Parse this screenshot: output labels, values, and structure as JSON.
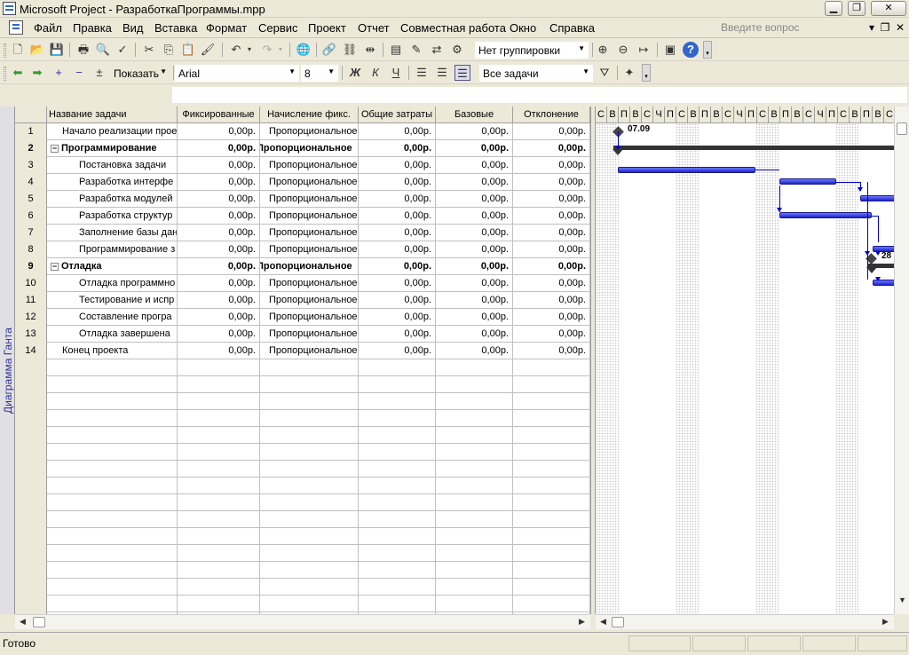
{
  "window": {
    "title": "Microsoft Project - РазработкаПрограммы.mpp"
  },
  "menu": {
    "items": [
      "Файл",
      "Правка",
      "Вид",
      "Вставка",
      "Формат",
      "Сервис",
      "Проект",
      "Отчет",
      "Совместная работа",
      "Окно",
      "Справка"
    ],
    "help_placeholder": "Введите вопрос"
  },
  "toolbar": {
    "grouping": "Нет группировки",
    "show_label": "Показать",
    "font": "Arial",
    "font_size": "8",
    "bold": "Ж",
    "italic": "К",
    "underline": "Ч",
    "filter": "Все задачи"
  },
  "view": {
    "label": "Диаграмма Ганта"
  },
  "table": {
    "columns": [
      "Название задачи",
      "Фиксированные",
      "Начисление фикс.",
      "Общие затраты",
      "Базовые",
      "Отклонение"
    ],
    "rows": [
      {
        "n": "1",
        "name": "Начало реализации прое",
        "fixed": "0,00р.",
        "accrual": "Пропорциональное",
        "total": "0,00р.",
        "baseline": "0,00р.",
        "variance": "0,00р."
      },
      {
        "n": "2",
        "name": "Программирование",
        "fixed": "0,00р.",
        "accrual": "Пропорциональное",
        "total": "0,00р.",
        "baseline": "0,00р.",
        "variance": "0,00р."
      },
      {
        "n": "3",
        "name": "Постановка задачи",
        "fixed": "0,00р.",
        "accrual": "Пропорциональное",
        "total": "0,00р.",
        "baseline": "0,00р.",
        "variance": "0,00р."
      },
      {
        "n": "4",
        "name": "Разработка интерфе",
        "fixed": "0,00р.",
        "accrual": "Пропорциональное",
        "total": "0,00р.",
        "baseline": "0,00р.",
        "variance": "0,00р."
      },
      {
        "n": "5",
        "name": "Разработка модулей",
        "fixed": "0,00р.",
        "accrual": "Пропорциональное",
        "total": "0,00р.",
        "baseline": "0,00р.",
        "variance": "0,00р."
      },
      {
        "n": "6",
        "name": "Разработка структур",
        "fixed": "0,00р.",
        "accrual": "Пропорциональное",
        "total": "0,00р.",
        "baseline": "0,00р.",
        "variance": "0,00р."
      },
      {
        "n": "7",
        "name": "Заполнение базы дан",
        "fixed": "0,00р.",
        "accrual": "Пропорциональное",
        "total": "0,00р.",
        "baseline": "0,00р.",
        "variance": "0,00р."
      },
      {
        "n": "8",
        "name": "Программирование з",
        "fixed": "0,00р.",
        "accrual": "Пропорциональное",
        "total": "0,00р.",
        "baseline": "0,00р.",
        "variance": "0,00р."
      },
      {
        "n": "9",
        "name": "Отладка",
        "fixed": "0,00р.",
        "accrual": "Пропорциональное",
        "total": "0,00р.",
        "baseline": "0,00р.",
        "variance": "0,00р."
      },
      {
        "n": "10",
        "name": "Отладка программно",
        "fixed": "0,00р.",
        "accrual": "Пропорциональное",
        "total": "0,00р.",
        "baseline": "0,00р.",
        "variance": "0,00р."
      },
      {
        "n": "11",
        "name": "Тестирование и испр",
        "fixed": "0,00р.",
        "accrual": "Пропорциональное",
        "total": "0,00р.",
        "baseline": "0,00р.",
        "variance": "0,00р."
      },
      {
        "n": "12",
        "name": "Составление програ",
        "fixed": "0,00р.",
        "accrual": "Пропорциональное",
        "total": "0,00р.",
        "baseline": "0,00р.",
        "variance": "0,00р."
      },
      {
        "n": "13",
        "name": "Отладка завершена",
        "fixed": "0,00р.",
        "accrual": "Пропорциональное",
        "total": "0,00р.",
        "baseline": "0,00р.",
        "variance": "0,00р."
      },
      {
        "n": "14",
        "name": "Конец проекта",
        "fixed": "0,00р.",
        "accrual": "Пропорциональное",
        "total": "0,00р.",
        "baseline": "0,00р.",
        "variance": "0,00р."
      }
    ]
  },
  "gantt": {
    "days": [
      "С",
      "В",
      "П",
      "В",
      "С",
      "Ч",
      "П",
      "С",
      "В",
      "П",
      "В",
      "С",
      "Ч",
      "П",
      "С",
      "В",
      "П",
      "В",
      "С",
      "Ч",
      "П",
      "С",
      "В",
      "П",
      "В",
      "С"
    ],
    "milestone_start_label": "07.09",
    "milestone_debug_label": "28"
  },
  "status": {
    "text": "Готово"
  }
}
